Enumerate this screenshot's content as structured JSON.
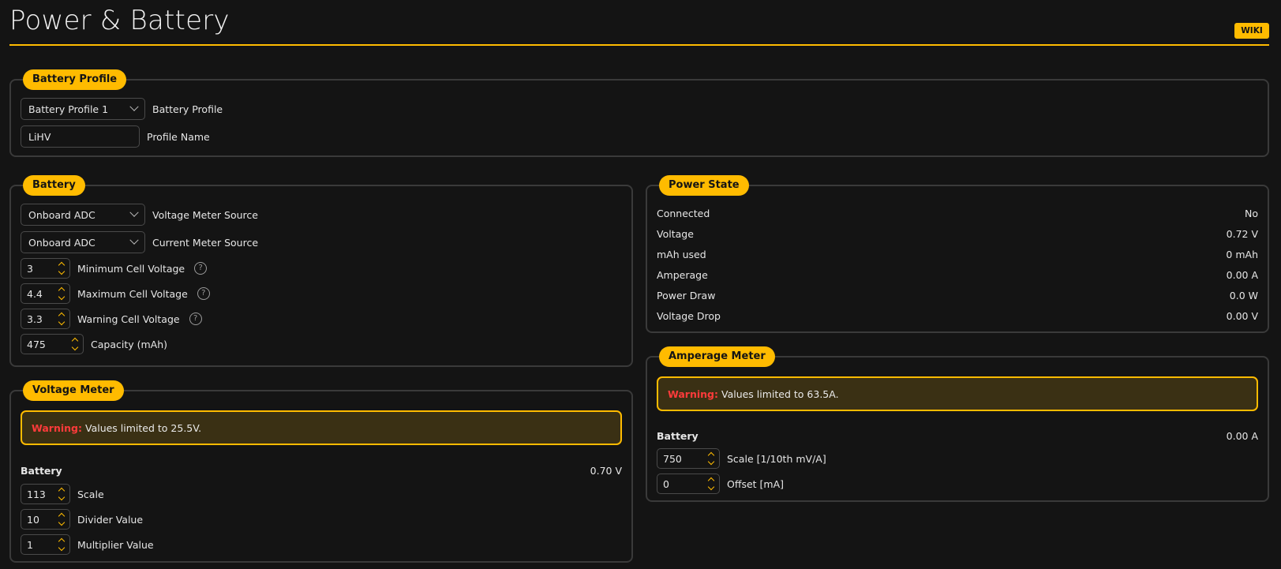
{
  "header": {
    "title": "Power & Battery",
    "wiki_label": "WIKI"
  },
  "battery_profile": {
    "title": "Battery Profile",
    "profile_select": "Battery Profile 1",
    "profile_label": "Battery Profile",
    "name_value": "LiHV",
    "name_label": "Profile Name"
  },
  "battery": {
    "title": "Battery",
    "voltage_source": "Onboard ADC",
    "voltage_source_label": "Voltage Meter Source",
    "current_source": "Onboard ADC",
    "current_source_label": "Current Meter Source",
    "min_cell": "3",
    "min_cell_label": "Minimum Cell Voltage",
    "max_cell": "4.4",
    "max_cell_label": "Maximum Cell Voltage",
    "warn_cell": "3.3",
    "warn_cell_label": "Warning Cell Voltage",
    "capacity": "475",
    "capacity_label": "Capacity (mAh)",
    "help_glyph": "?"
  },
  "voltage_meter": {
    "title": "Voltage Meter",
    "warning_prefix": "Warning:",
    "warning_text": "Values limited to 25.5V.",
    "battery_label": "Battery",
    "battery_value": "0.70 V",
    "scale": "113",
    "scale_label": "Scale",
    "divider": "10",
    "divider_label": "Divider Value",
    "multiplier": "1",
    "multiplier_label": "Multiplier Value"
  },
  "power_state": {
    "title": "Power State",
    "rows": [
      {
        "label": "Connected",
        "value": "No"
      },
      {
        "label": "Voltage",
        "value": "0.72 V"
      },
      {
        "label": "mAh used",
        "value": "0 mAh"
      },
      {
        "label": "Amperage",
        "value": "0.00 A"
      },
      {
        "label": "Power Draw",
        "value": "0.0 W"
      },
      {
        "label": "Voltage Drop",
        "value": "0.00 V"
      }
    ]
  },
  "amperage_meter": {
    "title": "Amperage Meter",
    "warning_prefix": "Warning:",
    "warning_text": "Values limited to 63.5A.",
    "battery_label": "Battery",
    "battery_value": "0.00 A",
    "scale": "750",
    "scale_label": "Scale [1/10th mV/A]",
    "offset": "0",
    "offset_label": "Offset [mA]"
  },
  "colors": {
    "accent": "#ffbb00",
    "background": "#141414",
    "warning_text": "#ff3b3b"
  }
}
